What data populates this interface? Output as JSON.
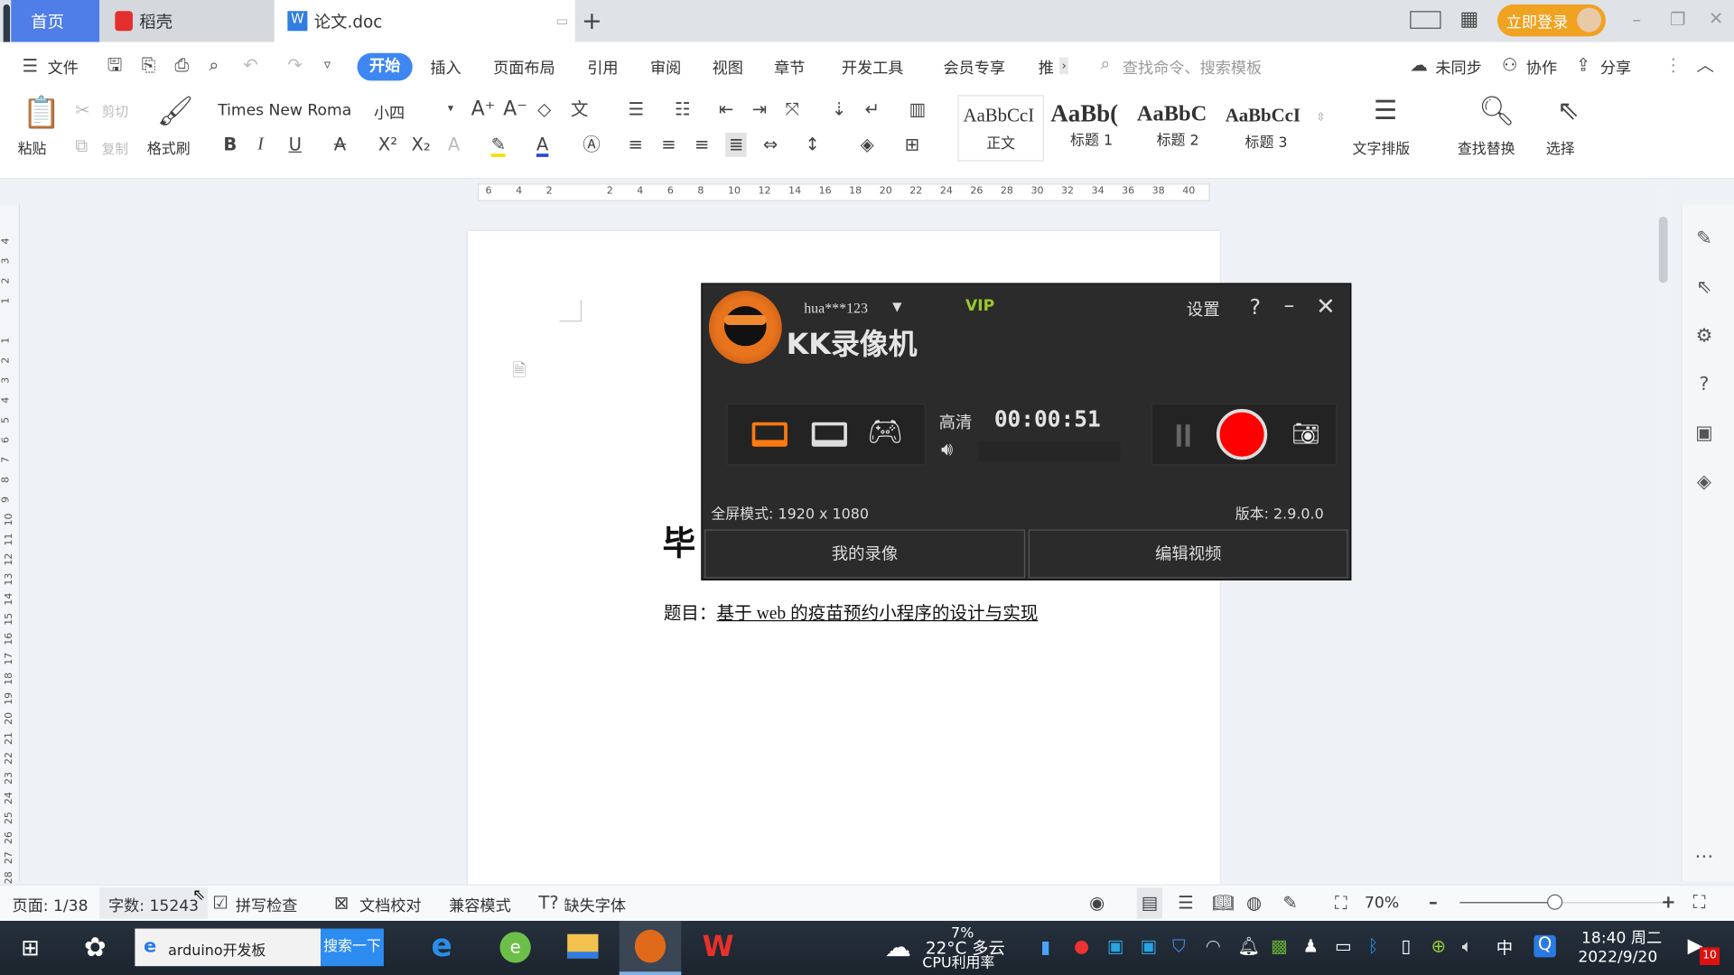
{
  "tabs": {
    "home": "首页",
    "docer": "稻壳",
    "doc": "论文.doc",
    "add": "+",
    "login": "立即登录"
  },
  "menu": {
    "file": "文件",
    "items": [
      "开始",
      "插入",
      "页面布局",
      "引用",
      "审阅",
      "视图",
      "章节",
      "开发工具",
      "会员专享",
      "推"
    ],
    "search_placeholder": "查找命令、搜索模板",
    "sync": "未同步",
    "collab": "协作",
    "share": "分享"
  },
  "ribbon": {
    "paste": "粘贴",
    "cut": "剪切",
    "copy": "复制",
    "format_painter": "格式刷",
    "font": "Times New Roma",
    "size": "小四",
    "styles": [
      {
        "preview": "AaBbCcI",
        "name": "正文"
      },
      {
        "preview": "AaBb(",
        "name": "标题 1"
      },
      {
        "preview": "AaBbC",
        "name": "标题 2"
      },
      {
        "preview": "AaBbCcI",
        "name": "标题 3"
      }
    ],
    "text_layout": "文字排版",
    "find_replace": "查找替换",
    "select": "选择"
  },
  "ruler": {
    "top": [
      "6",
      "4",
      "2",
      "",
      "2",
      "4",
      "6",
      "8",
      "10",
      "12",
      "14",
      "16",
      "18",
      "20",
      "22",
      "24",
      "26",
      "28",
      "30",
      "32",
      "34",
      "36",
      "38",
      "40"
    ],
    "left": [
      "4",
      "3",
      "2",
      "1",
      "",
      "1",
      "2",
      "3",
      "4",
      "5",
      "6",
      "7",
      "8",
      "9",
      "10",
      "11",
      "12",
      "13",
      "14",
      "15",
      "16",
      "17",
      "18",
      "19",
      "20",
      "21",
      "22",
      "23",
      "24",
      "25",
      "26",
      "27",
      "28"
    ]
  },
  "document": {
    "title_char": "毕",
    "subject_label": "题目：",
    "subject": "基于 web 的疫苗预约小程序的设计与实现"
  },
  "kk": {
    "user": "hua***123",
    "vip": "VIP",
    "settings": "设置",
    "help": "?",
    "app_name": "KK录像机",
    "quality": "高清",
    "timer": "00:00:51",
    "fullscreen_mode": "全屏模式: 1920 x 1080",
    "version": "版本: 2.9.0.0",
    "my_videos": "我的录像",
    "edit_video": "编辑视频",
    "accent": "#ff6a00",
    "record_color": "#ff0000"
  },
  "status": {
    "page": "页面: 1/38",
    "words": "字数: 15243",
    "spell": "拼写检查",
    "proof": "文档校对",
    "compat": "兼容模式",
    "missing_font": "缺失字体",
    "zoom": "70%",
    "zoom_fraction": 0.47
  },
  "taskbar": {
    "search_text": "arduino开发板",
    "search_btn": "搜索一下",
    "cpu": "7%",
    "cpu_label": "CPU利用率",
    "weather": "22°C 多云",
    "ime": "中",
    "time": "18:40 周二",
    "date": "2022/9/20",
    "notif": "10"
  }
}
